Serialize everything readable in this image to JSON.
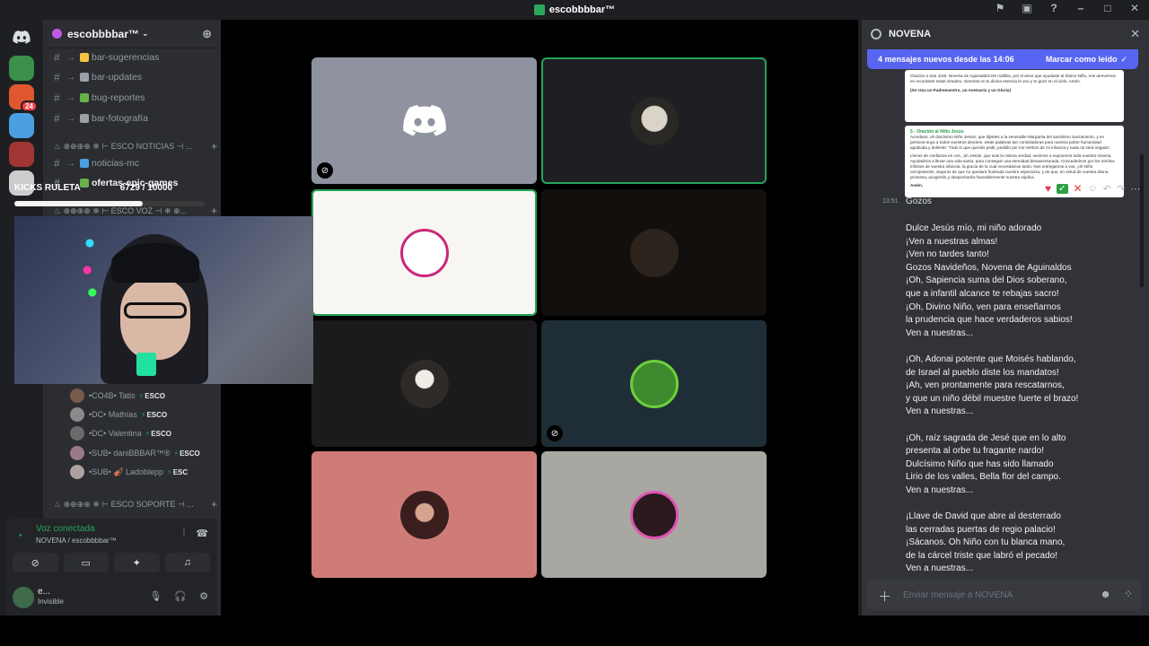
{
  "window": {
    "title": "escobbbbar™"
  },
  "rail": {
    "servers": [
      {
        "color": "#3a8f4a",
        "badge": ""
      },
      {
        "color": "#e0572f",
        "badge": "24"
      },
      {
        "color": "#4a9fe0",
        "badge": ""
      },
      {
        "color": "#a03535",
        "badge": ""
      },
      {
        "color": "#cccccc",
        "badge": ""
      }
    ]
  },
  "guild": {
    "name": "escobbbbar™"
  },
  "channels": [
    {
      "name": "bar-sugerencias",
      "emoji_color": "#f5c542",
      "icon": "#"
    },
    {
      "name": "bar-updates",
      "emoji_color": "#9aa0a6",
      "icon": "#"
    },
    {
      "name": "bug-reportes",
      "emoji_color": "#6ab04c",
      "icon": "#"
    },
    {
      "name": "bar-fotografía",
      "emoji_color": "#9aa0a6",
      "icon": "#"
    }
  ],
  "categories": [
    {
      "label": "♨ ⊕⊕⊕⊕ ❄ ⊢ ESCO NOTICIAS ⊣ ..."
    },
    {
      "label": "♨ ⊕⊕⊕⊕ ❄ ⊢ ESCO VOZ ⊣ ❄ ⊕..."
    },
    {
      "label": "♨ ⊕⊕⊕⊕ ❄ ⊢ ESCO SOPORTE ⊣ ..."
    }
  ],
  "news_channels": [
    {
      "name": "noticias-mc",
      "emoji_color": "#4a9fe0",
      "active": false
    },
    {
      "name": "ofertas-epic-games",
      "emoji_color": "#6ab04c",
      "active": true
    }
  ],
  "overlay": {
    "kicks_label": "KICKS RULETA",
    "kicks_count": "6729  / 10000",
    "kicks_progress": 0.6729
  },
  "members": [
    {
      "name": "•CO4B• Tatis",
      "tag": "ESCO",
      "color": "#7a5a4a"
    },
    {
      "name": "•DC• Mathías",
      "tag": "ESCO",
      "color": "#8a8a8a"
    },
    {
      "name": "•DC• Valentina",
      "tag": "ESCO",
      "color": "#6a6a6a"
    },
    {
      "name": "•SUB• daniBBBAR™®",
      "tag": "ESCO",
      "color": "#9a7a8a"
    },
    {
      "name": "•SUB• 🎻 Ladobleрр",
      "tag": "ESC",
      "color": "#b0a0a0"
    }
  ],
  "voice": {
    "status": "Voz conectada",
    "channel": "NOVENA / escobbbbar™"
  },
  "user": {
    "name": "e...",
    "status": "Invisible"
  },
  "tiles": [
    {
      "bg": "#8e939f",
      "avatar": "discord",
      "speaking": false,
      "muted": true
    },
    {
      "bg": "#1e1f22",
      "avatar": "dog",
      "speaking": true,
      "muted": false
    },
    {
      "bg": "#f8f6f2",
      "avatar": "pixel",
      "speaking": true,
      "muted": false
    },
    {
      "bg": "#120f0c",
      "avatar": "dark",
      "speaking": false,
      "muted": false
    },
    {
      "bg": "#1b1a1c",
      "avatar": "hat",
      "speaking": false,
      "muted": false
    },
    {
      "bg": "#1f2e36",
      "avatar": "banana",
      "speaking": false,
      "muted": true
    },
    {
      "bg": "#cf7c78",
      "avatar": "girl",
      "speaking": false,
      "muted": false
    },
    {
      "bg": "#a9a7a1",
      "avatar": "pink",
      "speaking": false,
      "muted": false
    }
  ],
  "thread": {
    "title": "NOVENA",
    "new_messages": "4 mensajes nuevos desde las 14:06",
    "mark_read": "Marcar como leído",
    "doc1_text": "Oración a San José. Novena de Aguinaldos De rodillas, por el amor que ayudaste al Divino Niño, nos atrevemos en recordarte estas virtudes, mientras en tu divina esencia le veo y te gozo en el cielo. Amén.",
    "doc1_footer": "(Se reza un Padrenuestro, un Avemaría y un Gloria)",
    "doc2_title": "5 - Oración al Niño Jesús",
    "doc2_text": "Acordaos, oh dulcísimo Niño Jesús!, que dijisteis a la venerable Margarita del santísimo Sacramento, y en persona suya a todos vuestros devotos, estas palabras tan consoladoras para nuestra pobre humanidad agobiada y doliente: 'Todo lo que queráis pedir, pedidlo por los méritos de mi infancia y nada os será negado'.",
    "doc2_text2": "Llenos de confianza en vos, ¡oh Jesús!, que sois la misma verdad, venimos a exponeros toda nuestra miseria. Ayudadnos a llevar una vida santa, para conseguir una eternidad bienaventurada. Concedednos por los méritos infinitos de vuestra infancia, la gracia de la cual necesitamos tanto. Nos entregamos a vos, ¡oh Niño omnipotente!, seguros de que no quedará frustrada nuestra esperanza, y de que, en virtud de vuestra divina promesa, acogeréis y despacharéis favorablemente nuestra súplica.",
    "doc2_footer": "Amén.",
    "msg_time": "13:51",
    "msg_title": "Gozos",
    "stanzas": [
      [
        "Dulce Jesús mío, mi niño adorado",
        "¡Ven a nuestras almas!",
        "¡Ven no tardes tanto!",
        "Gozos Navideños, Novena de Aguinaldos",
        "¡Oh, Sapiencia suma del Dios soberano,",
        "que a infantil alcance te rebajas sacro!",
        "¡Oh, Divino Niño, ven para enseñarnos",
        "la prudencia que hace verdaderos sabios!",
        "Ven a nuestras..."
      ],
      [
        "¡Oh, Adonai potente que Moisés hablando,",
        "de Israel al pueblo diste los mandatos!",
        "¡Ah, ven prontamente para rescatarnos,",
        "y que un niño débil muestre fuerte el brazo!",
        "Ven a nuestras..."
      ],
      [
        "¡Oh, raíz sagrada de Jesé que en lo alto",
        "presenta al orbe tu fragante nardo!",
        "Dulcísimo Niño que has sido llamado",
        "Lirio de los valles, Bella flor del campo.",
        "Ven a nuestras..."
      ],
      [
        "¡Llave de David que abre al desterrado",
        "las cerradas puertas de regio palacio!",
        "¡Sácanos. Oh Niño con tu blanca mano,",
        "de la cárcel triste que labró el pecado!",
        "Ven a nuestras..."
      ]
    ],
    "composer_placeholder": "Enviar mensaje a NOVENA"
  }
}
